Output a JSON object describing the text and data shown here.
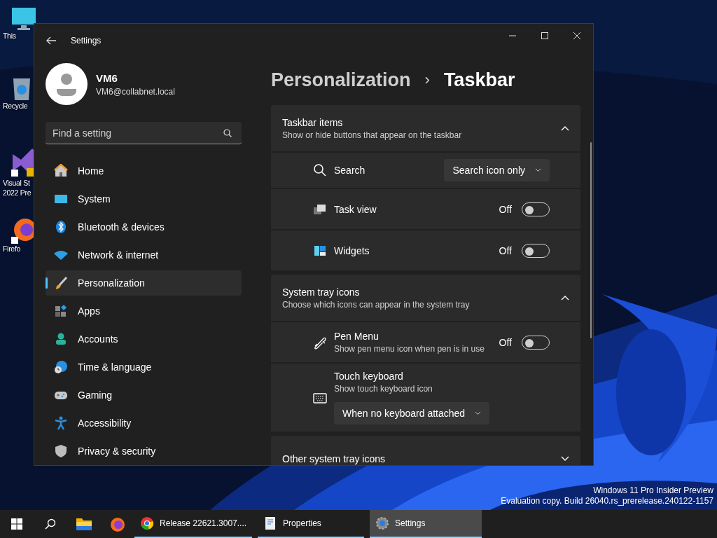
{
  "desktop": {
    "icons": [
      {
        "lines": [
          "This"
        ]
      },
      {
        "lines": [
          "Recycle"
        ]
      },
      {
        "lines": [
          "Visual St",
          "2022 Pre"
        ]
      },
      {
        "lines": [
          "Firefo"
        ]
      }
    ],
    "evaluation_notice": [
      "Windows 11 Pro Insider Preview",
      "Evaluation copy. Build 26040.rs_prerelease.240122-1157"
    ]
  },
  "window": {
    "title": "Settings"
  },
  "account": {
    "name": "VM6",
    "email": "VM6@collabnet.local"
  },
  "search": {
    "placeholder": "Find a setting"
  },
  "nav": [
    {
      "label": "Home",
      "selected": false
    },
    {
      "label": "System",
      "selected": false
    },
    {
      "label": "Bluetooth & devices",
      "selected": false
    },
    {
      "label": "Network & internet",
      "selected": false
    },
    {
      "label": "Personalization",
      "selected": true
    },
    {
      "label": "Apps",
      "selected": false
    },
    {
      "label": "Accounts",
      "selected": false
    },
    {
      "label": "Time & language",
      "selected": false
    },
    {
      "label": "Gaming",
      "selected": false
    },
    {
      "label": "Accessibility",
      "selected": false
    },
    {
      "label": "Privacy & security",
      "selected": false
    }
  ],
  "breadcrumb": {
    "parent": "Personalization",
    "separator": "›",
    "current": "Taskbar"
  },
  "sections": [
    {
      "title": "Taskbar items",
      "subtitle": "Show or hide buttons that appear on the taskbar",
      "expanded": true,
      "rows": [
        {
          "kind": "dropdown",
          "label": "Search",
          "value": "Search icon only"
        },
        {
          "kind": "toggle",
          "label": "Task view",
          "state_text": "Off",
          "on": false
        },
        {
          "kind": "toggle",
          "label": "Widgets",
          "state_text": "Off",
          "on": false
        }
      ]
    },
    {
      "title": "System tray icons",
      "subtitle": "Choose which icons can appear in the system tray",
      "expanded": true,
      "rows": [
        {
          "kind": "toggle",
          "label": "Pen Menu",
          "description": "Show pen menu icon when pen is in use",
          "state_text": "Off",
          "on": false
        },
        {
          "kind": "stacked-dropdown",
          "label": "Touch keyboard",
          "description": "Show touch keyboard icon",
          "value": "When no keyboard attached"
        }
      ]
    },
    {
      "title": "Other system tray icons",
      "expanded": false
    }
  ],
  "taskbar": {
    "apps": [
      {
        "label": "Release 22621.3007....",
        "running": true,
        "selected": false
      },
      {
        "label": "Properties",
        "running": true,
        "selected": false
      },
      {
        "label": "Settings",
        "running": true,
        "selected": true
      }
    ]
  }
}
